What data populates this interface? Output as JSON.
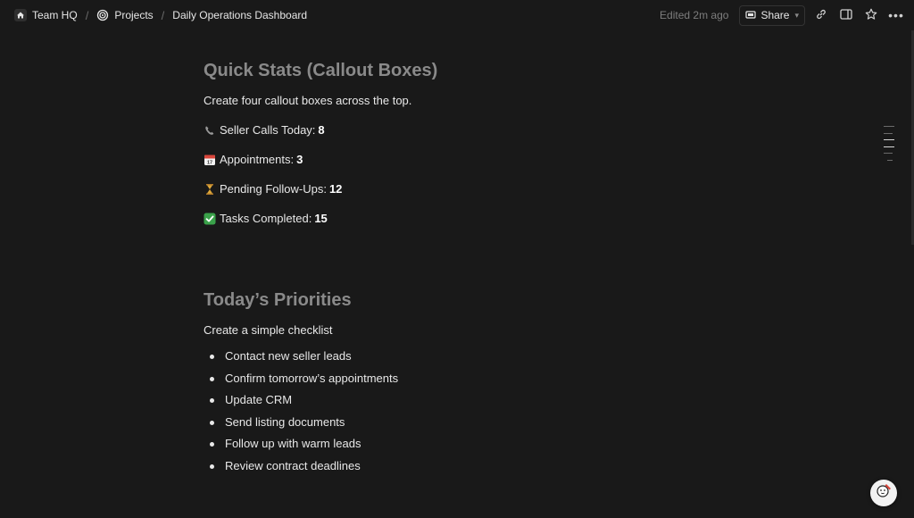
{
  "breadcrumb": {
    "items": [
      {
        "label": "Team HQ",
        "icon": "home-icon"
      },
      {
        "label": "Projects",
        "icon": "target-icon"
      },
      {
        "label": "Daily Operations Dashboard",
        "icon": ""
      }
    ],
    "separator": "/"
  },
  "topbar": {
    "edited": "Edited 2m ago",
    "share_label": "Share",
    "share_icon": "lock-share-icon",
    "icons": [
      "link-icon",
      "sidebar-panel-icon",
      "star-icon",
      "more-icon"
    ],
    "more_label": "•••"
  },
  "sections": {
    "quick_stats": {
      "heading": "Quick Stats (Callout Boxes)",
      "description": "Create four callout boxes across the top.",
      "stats": [
        {
          "icon": "phone-icon",
          "label": "Seller Calls Today:",
          "value": "8"
        },
        {
          "icon": "calendar-icon",
          "label": "Appointments:",
          "value": "3"
        },
        {
          "icon": "hourglass-icon",
          "label": "Pending Follow-Ups:",
          "value": "12"
        },
        {
          "icon": "checkmark-icon",
          "label": "Tasks Completed:",
          "value": "15"
        }
      ]
    },
    "priorities": {
      "heading": "Today’s Priorities",
      "description": "Create a simple checklist",
      "items": [
        "Contact new seller leads",
        "Confirm tomorrow’s appointments",
        "Update CRM",
        "Send listing documents",
        "Follow up with warm leads",
        "Review contract deadlines"
      ]
    }
  },
  "colors": {
    "background": "#191919",
    "heading": "#8a8a8a",
    "text": "#e8e8e8",
    "muted": "#7d7d7d",
    "check_green": "#3aa24a",
    "calendar_red": "#d9453a",
    "hourglass_gold": "#e0a93a"
  },
  "help_button_icon": "help-assistant-icon"
}
